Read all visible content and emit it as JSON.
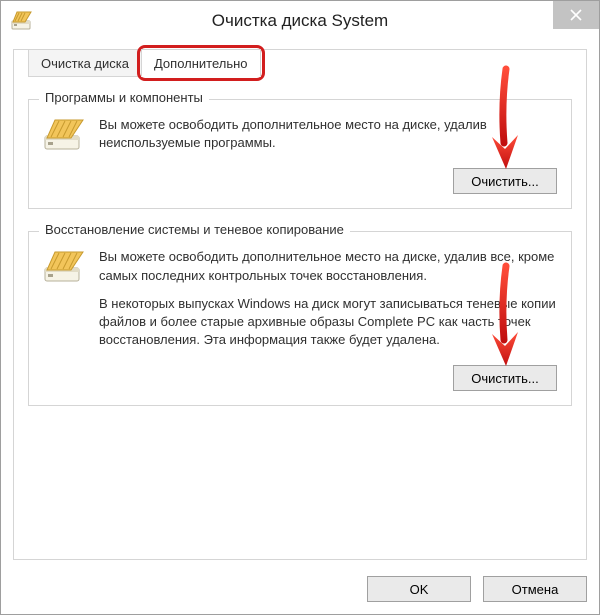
{
  "window": {
    "title": "Очистка диска System",
    "close_label": "Close"
  },
  "tabs": {
    "disk_cleanup": "Очистка диска",
    "more_options": "Дополнительно",
    "active": "more_options"
  },
  "group_programs": {
    "title": "Программы и компоненты",
    "text": "Вы можете освободить дополнительное место на диске, удалив неиспользуемые программы.",
    "cleanup_label": "Очистить..."
  },
  "group_restore": {
    "title": "Восстановление системы и теневое копирование",
    "text1": "Вы можете освободить дополнительное место на диске, удалив все, кроме самых последних контрольных точек восстановления.",
    "text2": "В некоторых выпусках Windows на диск могут записываться теневые копии файлов и более старые архивные образы Complete PC как часть точек восстановления. Эта информация также будет удалена.",
    "cleanup_label": "Очистить..."
  },
  "buttons": {
    "ok": "OK",
    "cancel": "Отмена"
  },
  "icons": {
    "title": "disk-cleanup-icon",
    "group": "disk-broom-icon",
    "close": "close-icon"
  },
  "annotations": {
    "highlight_tab": "more_options",
    "arrows": [
      "programs-cleanup-button",
      "restore-cleanup-button"
    ]
  },
  "colors": {
    "highlight": "#d21e1e",
    "arrow": "#d21e1e"
  }
}
